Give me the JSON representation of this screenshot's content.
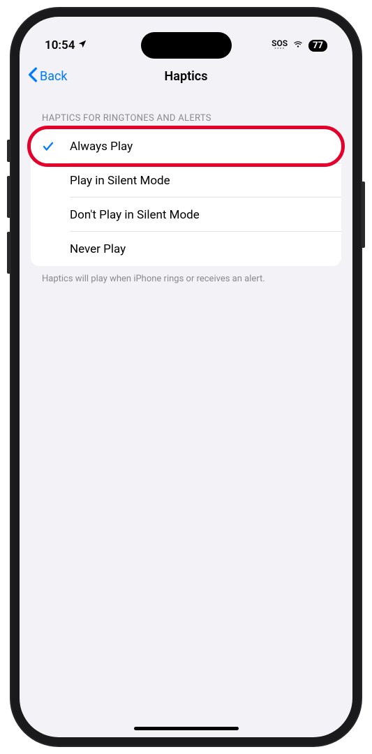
{
  "statusBar": {
    "time": "10:54",
    "sos": "SOS",
    "battery": "77"
  },
  "nav": {
    "back": "Back",
    "title": "Haptics"
  },
  "section": {
    "header": "HAPTICS FOR RINGTONES AND ALERTS",
    "options": {
      "alwaysPlay": "Always Play",
      "playInSilent": "Play in Silent Mode",
      "dontPlayInSilent": "Don't Play in Silent Mode",
      "neverPlay": "Never Play"
    },
    "footer": "Haptics will play when iPhone rings or receives an alert."
  }
}
